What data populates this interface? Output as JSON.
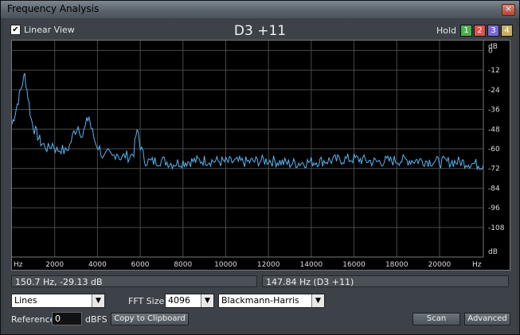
{
  "window": {
    "title": "Frequency Analysis",
    "close_glyph": "×"
  },
  "toolbar": {
    "linear_view_label": "Linear View",
    "linear_view_checked": true,
    "note_readout": "D3 +11",
    "hold_label": "Hold",
    "hold_buttons": [
      {
        "label": "1",
        "color": "#4caf50"
      },
      {
        "label": "2",
        "color": "#e0524a"
      },
      {
        "label": "3",
        "color": "#7a6ad8"
      },
      {
        "label": "4",
        "color": "#c8b060"
      }
    ]
  },
  "chart_data": {
    "type": "line",
    "x_unit_label": "Hz",
    "y_unit_label": "dB",
    "x_ticks": [
      "2000",
      "4000",
      "6000",
      "8000",
      "10000",
      "12000",
      "14000",
      "16000",
      "18000",
      "20000"
    ],
    "x_tick_values": [
      2000,
      4000,
      6000,
      8000,
      10000,
      12000,
      14000,
      16000,
      18000,
      20000
    ],
    "xlim": [
      0,
      22050
    ],
    "y_ticks": [
      "0",
      "-12",
      "-24",
      "-36",
      "-48",
      "-60",
      "-72",
      "-84",
      "-96",
      "-108"
    ],
    "y_tick_values": [
      0,
      -12,
      -24,
      -36,
      -48,
      -60,
      -72,
      -84,
      -96,
      -108
    ],
    "ylim": [
      -126,
      6
    ],
    "grid": true,
    "line_color": "#5ab4f0",
    "series": [
      {
        "x": [
          0,
          150,
          300,
          450,
          600,
          750,
          900,
          1050,
          1200,
          1350,
          1500,
          1700,
          1900,
          2100,
          2300,
          2500,
          2700,
          2900,
          3100,
          3300,
          3500,
          3600,
          3700,
          3900,
          4100,
          4300,
          4500,
          4700,
          4900,
          5100,
          5300,
          5500,
          5700,
          5800,
          5900,
          6000,
          6200,
          6500,
          7000,
          7500,
          8000,
          9000,
          10000,
          11000,
          12000,
          13000,
          14000,
          15000,
          16000,
          17000,
          18000,
          19000,
          20000,
          21000,
          22050
        ],
        "y": [
          -45,
          -38,
          -30,
          -22,
          -15,
          -28,
          -42,
          -48,
          -52,
          -56,
          -58,
          -60,
          -57,
          -61,
          -60,
          -62,
          -58,
          -50,
          -46,
          -52,
          -44,
          -40,
          -47,
          -56,
          -60,
          -66,
          -63,
          -65,
          -62,
          -66,
          -64,
          -65,
          -62,
          -52,
          -50,
          -58,
          -67,
          -68,
          -67,
          -69,
          -68,
          -67,
          -68,
          -68,
          -67,
          -69,
          -68,
          -67,
          -66,
          -68,
          -67,
          -67,
          -68,
          -68,
          -70
        ]
      }
    ]
  },
  "status": {
    "cursor_readout": "150.7 Hz, -29.13 dB",
    "peak_readout": "147.84 Hz (D3 +11)"
  },
  "controls": {
    "display_mode": "Lines",
    "fft_size_label": "FFT Size",
    "fft_size": "4096",
    "window_function": "Blackmann-Harris",
    "reference_label": "Reference",
    "reference_value": "0",
    "reference_unit": "dBFS",
    "copy_button": "Copy to Clipboard",
    "scan_button": "Scan",
    "advanced_button": "Advanced"
  }
}
